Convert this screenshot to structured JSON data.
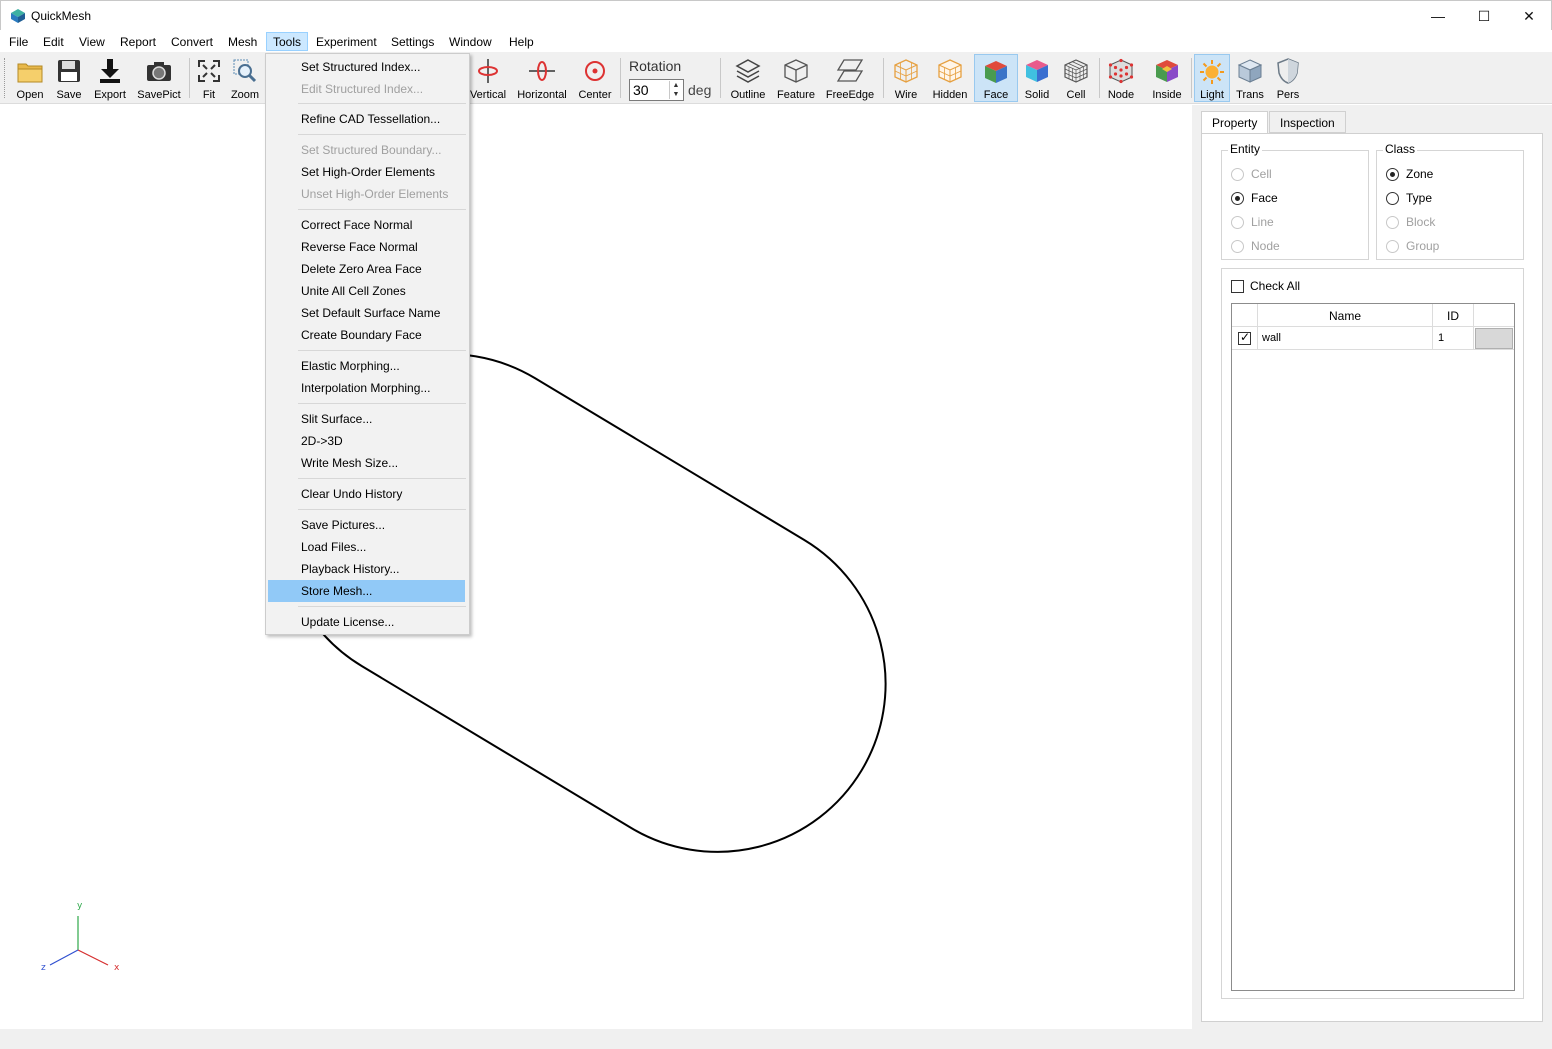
{
  "window": {
    "title": "QuickMesh",
    "controls": {
      "minimize": "—",
      "maximize": "☐",
      "close": "✕"
    }
  },
  "menubar": [
    "File",
    "Edit",
    "View",
    "Report",
    "Convert",
    "Mesh",
    "Tools",
    "Experiment",
    "Settings",
    "Window",
    "Help"
  ],
  "toolbar": {
    "open": "Open",
    "save": "Save",
    "export": "Export",
    "savepict": "SavePict",
    "fit": "Fit",
    "zoom": "Zoom",
    "vertical": "Vertical",
    "horizontal": "Horizontal",
    "center": "Center",
    "rotation_label": "Rotation",
    "rotation_value": "30",
    "rotation_unit": "deg",
    "outline": "Outline",
    "feature": "Feature",
    "freeedge": "FreeEdge",
    "wire": "Wire",
    "hidden": "Hidden",
    "face": "Face",
    "solid": "Solid",
    "cell": "Cell",
    "node": "Node",
    "inside": "Inside",
    "light": "Light",
    "trans": "Trans",
    "pers": "Pers"
  },
  "tools_menu": {
    "items": [
      {
        "label": "Set Structured Index...",
        "enabled": true
      },
      {
        "label": "Edit Structured Index...",
        "enabled": false
      },
      {
        "label": "Refine CAD Tessellation...",
        "enabled": true
      },
      {
        "label": "Set Structured Boundary...",
        "enabled": false
      },
      {
        "label": "Set High-Order Elements",
        "enabled": true
      },
      {
        "label": "Unset High-Order Elements",
        "enabled": false
      },
      {
        "label": "Correct Face Normal",
        "enabled": true
      },
      {
        "label": "Reverse Face Normal",
        "enabled": true
      },
      {
        "label": "Delete Zero Area Face",
        "enabled": true
      },
      {
        "label": "Unite All Cell Zones",
        "enabled": true
      },
      {
        "label": "Set Default Surface Name",
        "enabled": true
      },
      {
        "label": "Create Boundary Face",
        "enabled": true
      },
      {
        "label": "Elastic Morphing...",
        "enabled": true
      },
      {
        "label": "Interpolation Morphing...",
        "enabled": true
      },
      {
        "label": "Slit Surface...",
        "enabled": true
      },
      {
        "label": "2D->3D",
        "enabled": true
      },
      {
        "label": "Write Mesh Size...",
        "enabled": true
      },
      {
        "label": "Clear Undo History",
        "enabled": true
      },
      {
        "label": "Save Pictures...",
        "enabled": true
      },
      {
        "label": "Load Files...",
        "enabled": true
      },
      {
        "label": "Playback History...",
        "enabled": true
      },
      {
        "label": "Store Mesh...",
        "enabled": true,
        "highlighted": true
      },
      {
        "label": "Update License...",
        "enabled": true
      }
    ]
  },
  "axes": {
    "x": "x",
    "y": "y",
    "z": "z"
  },
  "panel": {
    "tabs": [
      "Property",
      "Inspection"
    ],
    "entity": {
      "title": "Entity",
      "options": [
        {
          "label": "Cell",
          "enabled": false,
          "selected": false
        },
        {
          "label": "Face",
          "enabled": true,
          "selected": true
        },
        {
          "label": "Line",
          "enabled": false,
          "selected": false
        },
        {
          "label": "Node",
          "enabled": false,
          "selected": false
        }
      ]
    },
    "class": {
      "title": "Class",
      "options": [
        {
          "label": "Zone",
          "enabled": true,
          "selected": true
        },
        {
          "label": "Type",
          "enabled": true,
          "selected": false
        },
        {
          "label": "Block",
          "enabled": false,
          "selected": false
        },
        {
          "label": "Group",
          "enabled": false,
          "selected": false
        }
      ]
    },
    "check_all": "Check All",
    "table": {
      "columns": [
        "",
        "Name",
        "ID",
        ""
      ],
      "rows": [
        {
          "checked": true,
          "name": "wall",
          "id": "1"
        }
      ]
    }
  },
  "colors": {
    "menu_highlight": "#91c9f7",
    "pressed": "#cce4f7"
  }
}
